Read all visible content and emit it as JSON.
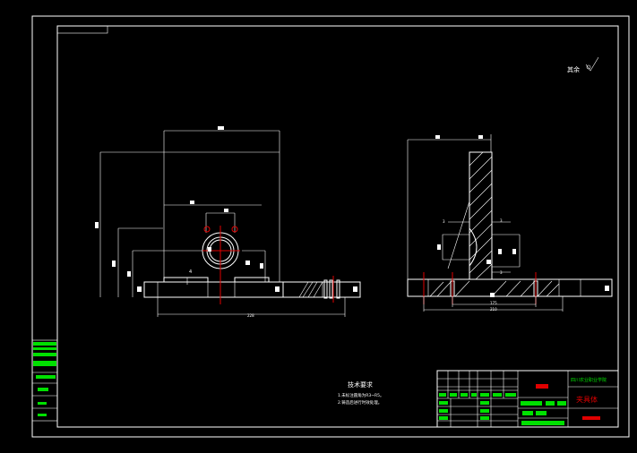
{
  "colors": {
    "background": "#000000",
    "line": "#ffffff",
    "center_line": "#e00000",
    "green_block": "#00e000",
    "red_block": "#e00000"
  },
  "roughness_note": "其余",
  "notes": {
    "title": "技术要求",
    "items": [
      "1.未标注圆角为R3~R5。",
      "2.铸造后进行时效处理。"
    ]
  },
  "dimensions": {
    "front_bottom": "228",
    "front_small": "4",
    "side_a": "3",
    "side_b": "3",
    "side_c": "3",
    "side_bottom1": "175",
    "side_bottom2": "210"
  },
  "title_block": {
    "school": "四川农业职业学院",
    "part_name": "夹具体"
  }
}
